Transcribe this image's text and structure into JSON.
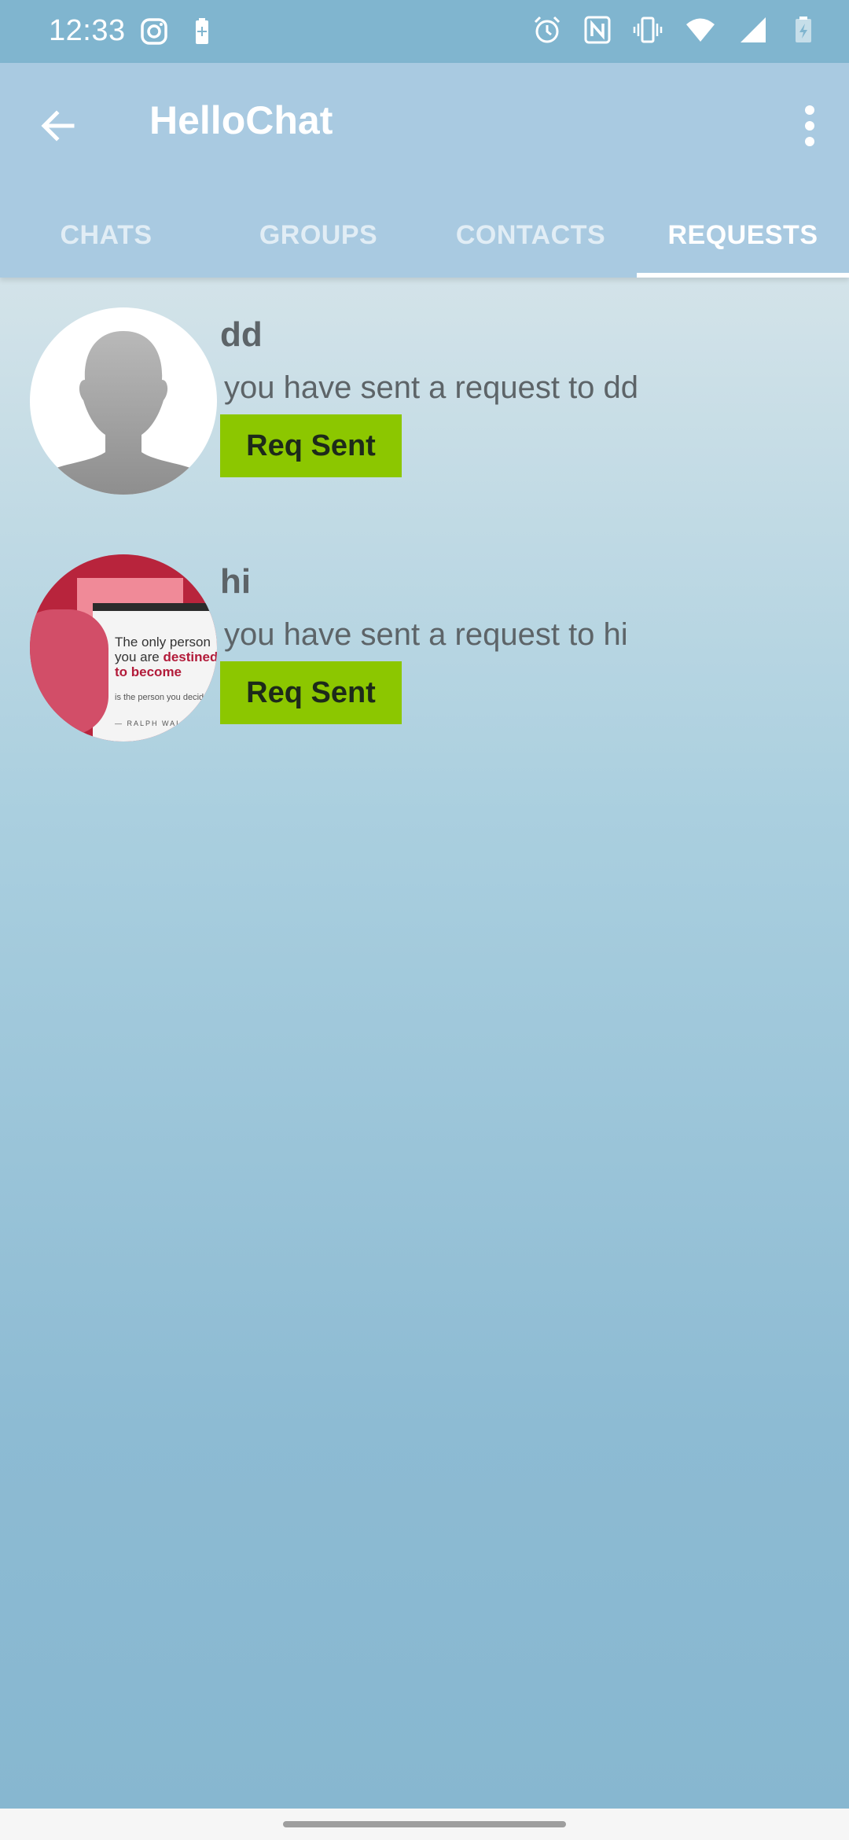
{
  "status_bar": {
    "time": "12:33",
    "left_icons": [
      "instagram-icon",
      "battery-saver-icon"
    ],
    "right_icons": [
      "alarm-icon",
      "nfc-icon",
      "vibrate-icon",
      "wifi-icon",
      "signal-icon",
      "battery-icon"
    ]
  },
  "app_bar": {
    "title": "HelloChat",
    "back_icon": "arrow-left-icon",
    "menu_icon": "more-vertical-icon"
  },
  "tabs": [
    {
      "label": "CHATS",
      "active": false
    },
    {
      "label": "GROUPS",
      "active": false
    },
    {
      "label": "CONTACTS",
      "active": false
    },
    {
      "label": "REQUESTS",
      "active": true
    }
  ],
  "requests": [
    {
      "name": "dd",
      "message": "you have sent a request to dd",
      "button_label": "Req Sent",
      "avatar": "default-person-icon"
    },
    {
      "name": "hi",
      "message": "you have sent a request to hi",
      "button_label": "Req Sent",
      "avatar": "quote-image",
      "avatar_text": {
        "line1": "The only person",
        "line2a": "you are ",
        "line2b": "destined",
        "line3": "to become",
        "line4": "is the person you decide",
        "line5": "— RALPH WALDO"
      }
    }
  ],
  "colors": {
    "status_bar": "#80b5cf",
    "app_bar": "#a9cae1",
    "button": "#8cc700",
    "text": "#5d6468"
  }
}
